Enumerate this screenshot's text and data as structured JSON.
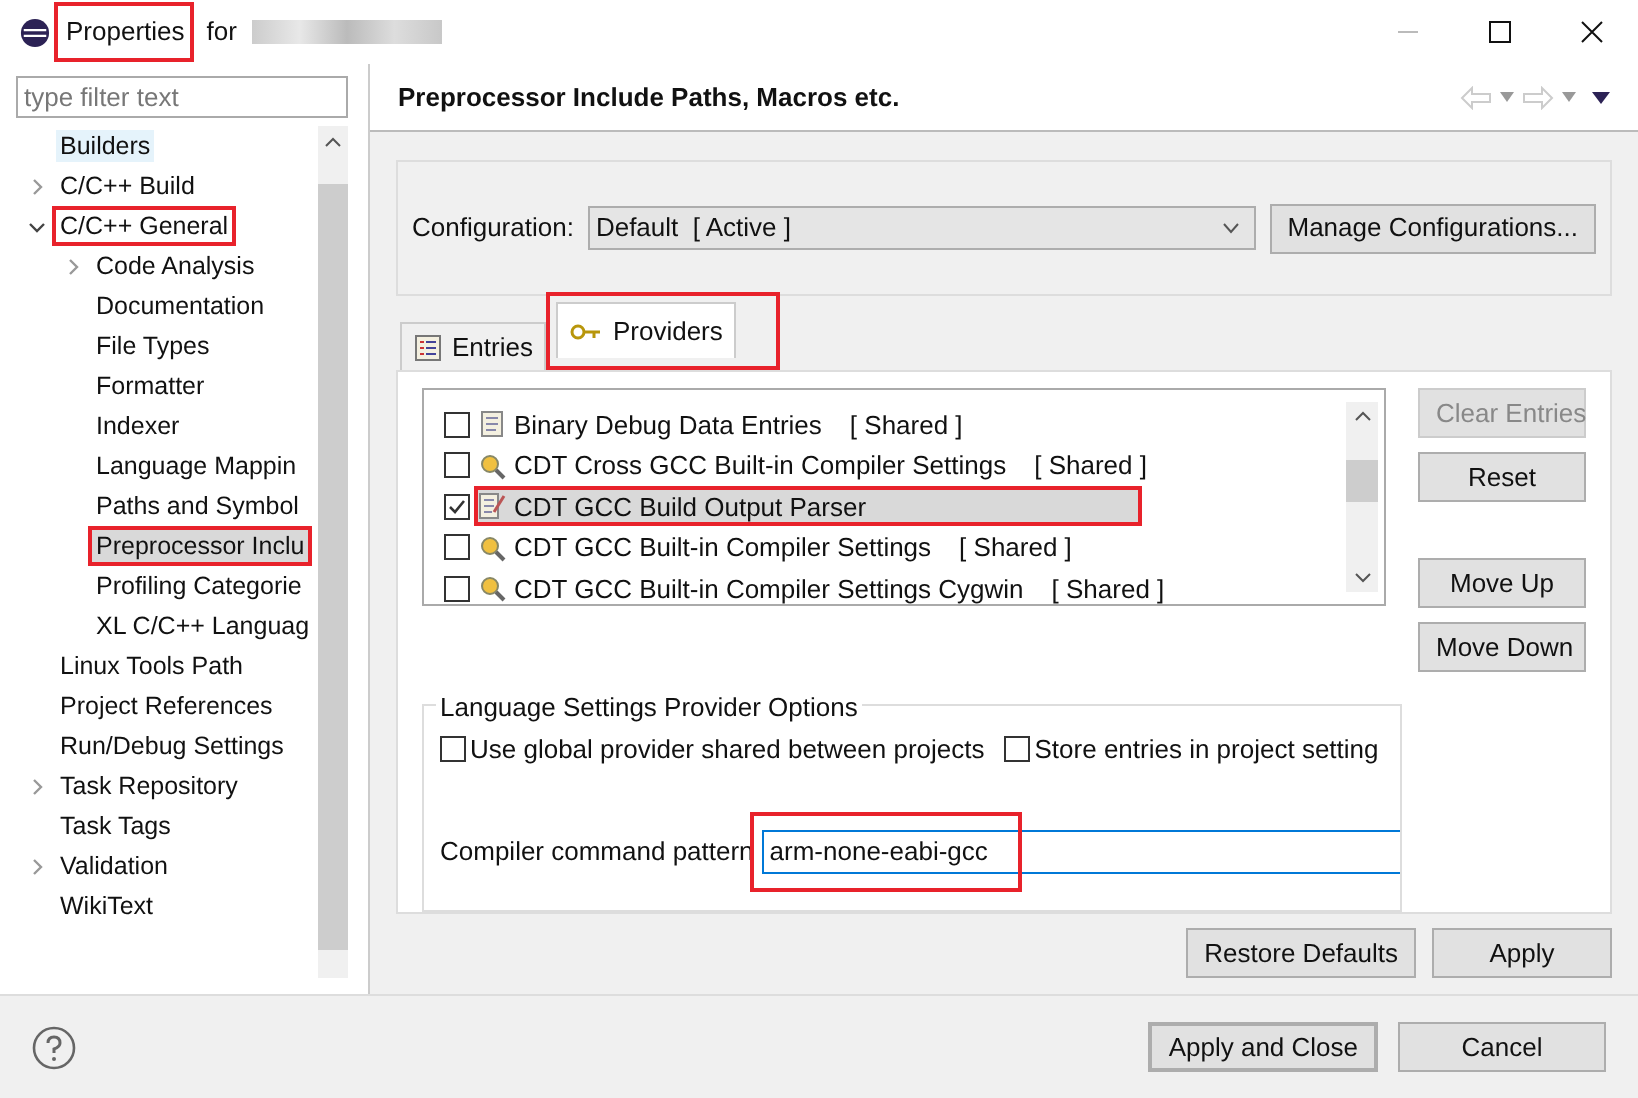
{
  "window": {
    "title": "Properties",
    "title_suffix": "for",
    "title_annotated": true
  },
  "filter": {
    "placeholder": "type filter text"
  },
  "tree": [
    {
      "label": "Builders",
      "selected": false,
      "highlighted": true,
      "annotated": false
    },
    {
      "label": "C/C++ Build",
      "selected": false,
      "highlighted": false,
      "annotated": false,
      "expanded": false
    },
    {
      "label": "C/C++ General",
      "selected": false,
      "highlighted": false,
      "annotated": true,
      "expanded": true,
      "children": [
        {
          "label": "Code Analysis",
          "selected": false,
          "highlighted": false,
          "annotated": false,
          "expanded": false
        },
        {
          "label": "Documentation",
          "selected": false,
          "highlighted": false,
          "annotated": false
        },
        {
          "label": "File Types",
          "selected": false,
          "highlighted": false,
          "annotated": false
        },
        {
          "label": "Formatter",
          "selected": false,
          "highlighted": false,
          "annotated": false
        },
        {
          "label": "Indexer",
          "selected": false,
          "highlighted": false,
          "annotated": false
        },
        {
          "label": "Language Mappin",
          "selected": false,
          "highlighted": false,
          "annotated": false
        },
        {
          "label": "Paths and Symbol",
          "selected": false,
          "highlighted": false,
          "annotated": false
        },
        {
          "label": "Preprocessor Inclu",
          "selected": true,
          "highlighted": false,
          "annotated": true
        },
        {
          "label": "Profiling Categorie",
          "selected": false,
          "highlighted": false,
          "annotated": false
        },
        {
          "label": "XL C/C++ Languag",
          "selected": false,
          "highlighted": false,
          "annotated": false
        }
      ]
    },
    {
      "label": "Linux Tools Path",
      "selected": false,
      "highlighted": false,
      "annotated": false
    },
    {
      "label": "Project References",
      "selected": false,
      "highlighted": false,
      "annotated": false
    },
    {
      "label": "Run/Debug Settings",
      "selected": false,
      "highlighted": false,
      "annotated": false
    },
    {
      "label": "Task Repository",
      "selected": false,
      "highlighted": false,
      "annotated": false,
      "expanded": false
    },
    {
      "label": "Task Tags",
      "selected": false,
      "highlighted": false,
      "annotated": false
    },
    {
      "label": "Validation",
      "selected": false,
      "highlighted": false,
      "annotated": false,
      "expanded": false
    },
    {
      "label": "WikiText",
      "selected": false,
      "highlighted": false,
      "annotated": false
    }
  ],
  "page": {
    "title": "Preprocessor Include Paths, Macros etc."
  },
  "configuration": {
    "label": "Configuration:",
    "value": "Default  [ Active ]",
    "manage_button": "Manage Configurations..."
  },
  "tabs": [
    {
      "label": "Entries",
      "selected": false,
      "annotated": false,
      "kind": "entries"
    },
    {
      "label": "Providers",
      "selected": true,
      "annotated": true,
      "kind": "providers"
    }
  ],
  "providers": [
    {
      "name": "Binary Debug Data Entries",
      "tag": "[ Shared ]",
      "checked": false,
      "selected": false,
      "annotated": false,
      "kind": "document"
    },
    {
      "name": "CDT Cross GCC Built-in Compiler Settings",
      "tag": "[ Shared ]",
      "checked": false,
      "selected": false,
      "annotated": false,
      "kind": "builtin"
    },
    {
      "name": "CDT GCC Build Output Parser",
      "checked": true,
      "selected": true,
      "annotated": true,
      "kind": "parser"
    },
    {
      "name": "CDT GCC Built-in Compiler Settings",
      "tag": "[ Shared ]",
      "checked": false,
      "selected": false,
      "annotated": false,
      "kind": "builtin"
    },
    {
      "name": "CDT GCC Built-in Compiler Settings Cygwin",
      "tag": "[ Shared ]",
      "checked": false,
      "selected": false,
      "annotated": false,
      "kind": "builtin"
    }
  ],
  "side_buttons": [
    {
      "label": "Clear Entries",
      "disabled": true
    },
    {
      "label": "Reset",
      "disabled": false
    },
    {
      "label": "Move Up",
      "disabled": false
    },
    {
      "label": "Move Down",
      "disabled": false
    }
  ],
  "options": {
    "title": "Language Settings Provider Options",
    "checkboxes": [
      {
        "label": "Use global provider shared between projects",
        "checked": false
      },
      {
        "label": "Store entries in project setting",
        "checked": false
      }
    ],
    "pattern_label": "Compiler command pattern",
    "pattern_value": "arm-none-eabi-gcc",
    "pattern_annotated": true
  },
  "page_buttons": [
    "Restore Defaults",
    "Apply"
  ],
  "dialog_buttons": [
    {
      "label": "Apply and Close",
      "default": true
    },
    {
      "label": "Cancel",
      "default": false
    }
  ]
}
